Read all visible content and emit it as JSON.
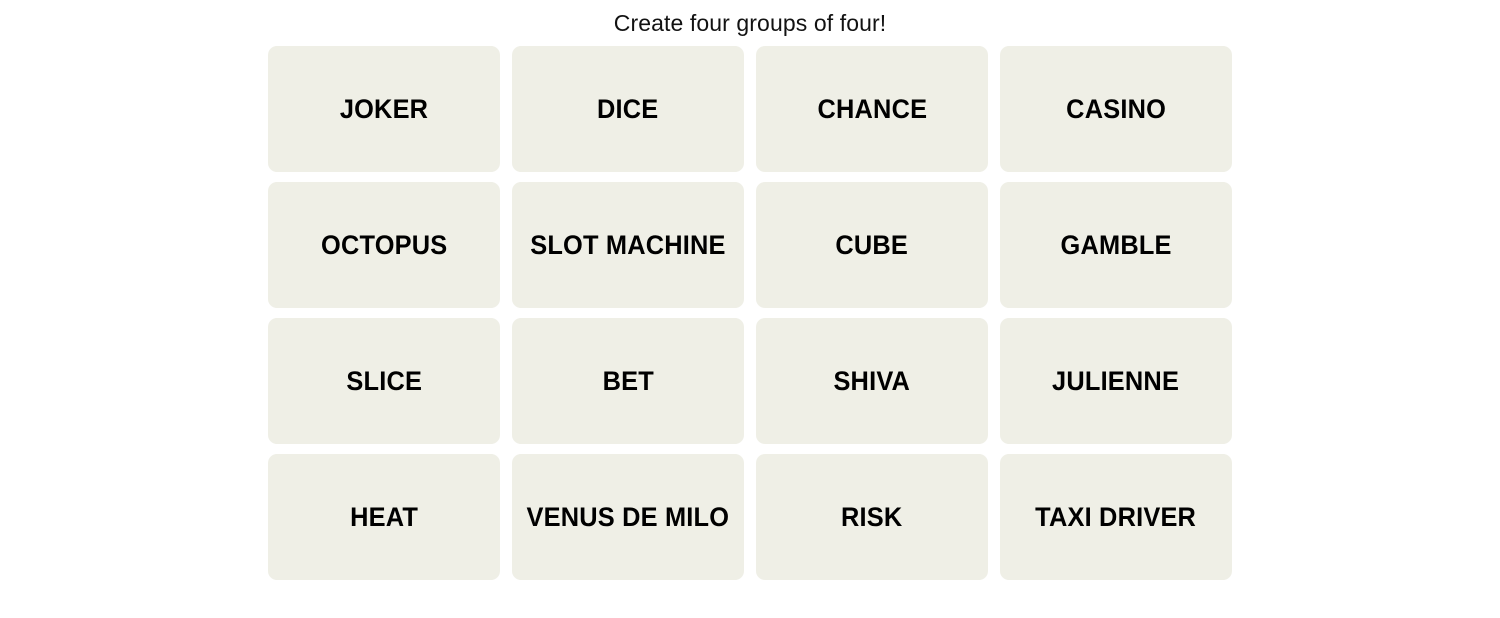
{
  "header": {
    "title": "Create four groups of four!"
  },
  "colors": {
    "page_background": "#ffffff",
    "tile_background": "#efefe6",
    "tile_text": "#000000",
    "title_text": "#121212"
  },
  "grid": {
    "rows": 4,
    "columns": 4,
    "tiles": [
      {
        "label": "JOKER"
      },
      {
        "label": "DICE"
      },
      {
        "label": "CHANCE"
      },
      {
        "label": "CASINO"
      },
      {
        "label": "OCTOPUS"
      },
      {
        "label": "SLOT MACHINE"
      },
      {
        "label": "CUBE"
      },
      {
        "label": "GAMBLE"
      },
      {
        "label": "SLICE"
      },
      {
        "label": "BET"
      },
      {
        "label": "SHIVA"
      },
      {
        "label": "JULIENNE"
      },
      {
        "label": "HEAT"
      },
      {
        "label": "VENUS DE MILO"
      },
      {
        "label": "RISK"
      },
      {
        "label": "TAXI DRIVER"
      }
    ]
  }
}
